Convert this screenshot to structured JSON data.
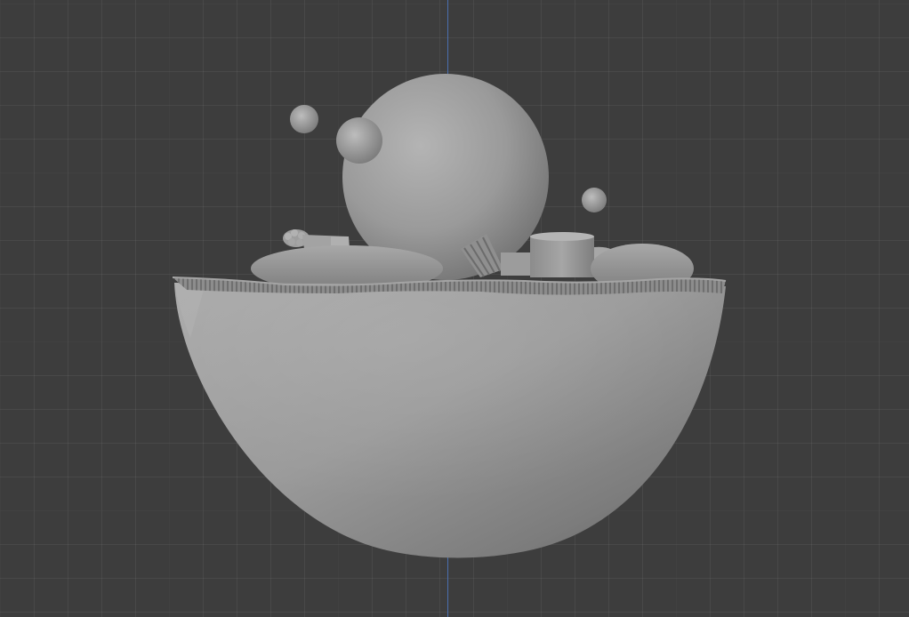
{
  "viewport": {
    "view": "front-orthographic",
    "shading": "solid",
    "grid": true,
    "axis_visible": "z",
    "colors": {
      "background": "#3d3d3d",
      "z_axis": "#4a6fb0",
      "model": "#9a9a9a"
    }
  },
  "scene_objects": [
    "cell-hemisphere",
    "nucleus-sphere",
    "small-sphere-1",
    "small-sphere-2",
    "small-sphere-3",
    "organelle-blob-left",
    "organelle-blob-right",
    "cylinder",
    "bundle-fibers",
    "knot-cluster",
    "membrane-rim"
  ]
}
